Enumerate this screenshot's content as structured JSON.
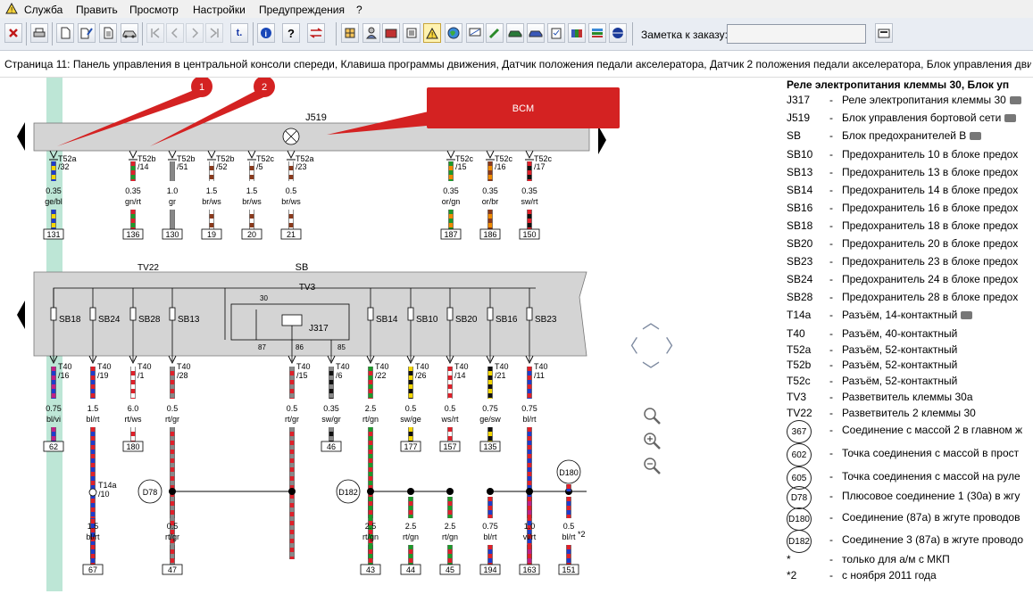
{
  "menu": {
    "items": [
      "Служба",
      "Править",
      "Просмотр",
      "Настройки",
      "Предупреждения",
      "?"
    ]
  },
  "toolbar": {
    "note_label": "Заметка к заказу:",
    "note_value": "",
    "icons": [
      "close-icon",
      "print-icon",
      "new-document-icon",
      "edit-icon",
      "document-icon",
      "car-icon",
      "first-page-icon",
      "prev-page-icon",
      "next-page-icon",
      "last-page-icon",
      "text-icon",
      "info-icon",
      "help-icon",
      "exchange-icon",
      "grid-icon",
      "person-icon",
      "book-icon",
      "list-icon",
      "warning-icon",
      "globe-icon",
      "monitor-icon",
      "pencil-icon",
      "car-icon",
      "search-car-icon",
      "clipboard-icon",
      "books-icon",
      "stack-icon",
      "disc-icon",
      "settings-icon"
    ]
  },
  "page": {
    "title": "Страница 11: Панель управления в центральной консоли спереди, Клавиша программы движения, Датчик положения педали акселератора, Датчик 2 положения педали акселератора, Блок управления двига"
  },
  "diagram": {
    "callouts": [
      "1",
      "2"
    ],
    "bcm_label": "BCM",
    "j519_label": "J519",
    "sb_label": "SB",
    "tv22_label": "TV22",
    "tv3_label": "TV3",
    "j317_label": "J317",
    "relay_pins": [
      "30",
      "87",
      "86",
      "85"
    ],
    "top_wires": [
      {
        "conn": "T52a",
        "pin": "/32",
        "size": "0.35",
        "color": "ge/bl",
        "box": "131",
        "c1": "#f4d600",
        "c2": "#1e3ccc"
      },
      {
        "conn": "T52b",
        "pin": "/14",
        "size": "0.35",
        "color": "gn/rt",
        "box": "136",
        "c1": "#1e9a2a",
        "c2": "#e0202a"
      },
      {
        "conn": "T52b",
        "pin": "/51",
        "size": "1.0",
        "color": "gr",
        "box": "130",
        "c1": "#888888",
        "c2": "#888888"
      },
      {
        "conn": "T52b",
        "pin": "/52",
        "size": "1.5",
        "color": "br/ws",
        "box": "19",
        "c1": "#8a3a1c",
        "c2": "#ffffff"
      },
      {
        "conn": "T52c",
        "pin": "/5",
        "size": "1.5",
        "color": "br/ws",
        "box": "20",
        "c1": "#8a3a1c",
        "c2": "#ffffff"
      },
      {
        "conn": "T52a",
        "pin": "/23",
        "size": "0.5",
        "color": "br/ws",
        "box": "21",
        "c1": "#8a3a1c",
        "c2": "#ffffff"
      },
      {
        "conn": "T52c",
        "pin": "/15",
        "size": "0.35",
        "color": "or/gn",
        "box": "187",
        "c1": "#f08a00",
        "c2": "#1e9a2a"
      },
      {
        "conn": "T52c",
        "pin": "/16",
        "size": "0.35",
        "color": "or/br",
        "box": "186",
        "c1": "#f08a00",
        "c2": "#8a3a1c"
      },
      {
        "conn": "T52c",
        "pin": "/17",
        "size": "0.35",
        "color": "sw/rt",
        "box": "150",
        "c1": "#111111",
        "c2": "#e0202a"
      }
    ],
    "fuses": [
      "SB18",
      "SB24",
      "SB28",
      "SB13",
      "SB14",
      "SB10",
      "SB20",
      "SB16",
      "SB23"
    ],
    "mid_wires": [
      {
        "conn": "T40",
        "pin": "/16",
        "size": "0.75",
        "color": "bl/vi",
        "box": "62",
        "c1": "#1e3ccc",
        "c2": "#c02088"
      },
      {
        "conn": "T40",
        "pin": "/19",
        "size": "1.5",
        "color": "bl/rt",
        "box": "",
        "c1": "#1e3ccc",
        "c2": "#e0202a"
      },
      {
        "conn": "T40",
        "pin": "/1",
        "size": "6.0",
        "color": "rt/ws",
        "box": "180",
        "c1": "#e0202a",
        "c2": "#ffffff"
      },
      {
        "conn": "T40",
        "pin": "/28",
        "size": "0.5",
        "color": "rt/gr",
        "box": "",
        "c1": "#e0202a",
        "c2": "#888888"
      },
      {
        "conn": "T40",
        "pin": "/15",
        "size": "0.5",
        "color": "rt/gr",
        "box": "",
        "c1": "#e0202a",
        "c2": "#888888"
      },
      {
        "conn": "T40",
        "pin": "/6",
        "size": "0.35",
        "color": "sw/gr",
        "box": "46",
        "c1": "#111111",
        "c2": "#888888"
      },
      {
        "conn": "T40",
        "pin": "/22",
        "size": "2.5",
        "color": "rt/gn",
        "box": "",
        "c1": "#e0202a",
        "c2": "#1e9a2a"
      },
      {
        "conn": "T40",
        "pin": "/26",
        "size": "0.5",
        "color": "sw/ge",
        "box": "177",
        "c1": "#111111",
        "c2": "#f4d600"
      },
      {
        "conn": "T40",
        "pin": "/14",
        "size": "0.5",
        "color": "ws/rt",
        "box": "157",
        "c1": "#ffffff",
        "c2": "#e0202a"
      },
      {
        "conn": "T40",
        "pin": "/21",
        "size": "0.75",
        "color": "ge/sw",
        "box": "135",
        "c1": "#f4d600",
        "c2": "#111111"
      },
      {
        "conn": "T40",
        "pin": "/11",
        "size": "0.75",
        "color": "bl/rt",
        "box": "",
        "c1": "#1e3ccc",
        "c2": "#e0202a"
      }
    ],
    "t14a": {
      "conn": "T14a",
      "pin": "/10"
    },
    "nodes": [
      "D78",
      "D182",
      "D180"
    ],
    "bottom_wires": [
      {
        "size": "1.5",
        "color": "bl/rt",
        "box": "67",
        "c1": "#1e3ccc",
        "c2": "#e0202a",
        "note": ""
      },
      {
        "size": "0.5",
        "color": "rt/gr",
        "box": "47",
        "c1": "#e0202a",
        "c2": "#888888",
        "note": ""
      },
      {
        "size": "2.5",
        "color": "rt/gn",
        "box": "43",
        "c1": "#e0202a",
        "c2": "#1e9a2a",
        "note": ""
      },
      {
        "size": "2.5",
        "color": "rt/gn",
        "box": "44",
        "c1": "#e0202a",
        "c2": "#1e9a2a",
        "note": ""
      },
      {
        "size": "2.5",
        "color": "rt/gn",
        "box": "45",
        "c1": "#e0202a",
        "c2": "#1e9a2a",
        "note": ""
      },
      {
        "size": "0.75",
        "color": "bl/rt",
        "box": "194",
        "c1": "#1e3ccc",
        "c2": "#e0202a",
        "note": ""
      },
      {
        "size": "1.0",
        "color": "vi/rt",
        "box": "163",
        "c1": "#c02088",
        "c2": "#e0202a",
        "note": ""
      },
      {
        "size": "0.5",
        "color": "bl/rt",
        "box": "151",
        "c1": "#1e3ccc",
        "c2": "#e0202a",
        "note": "*2"
      }
    ]
  },
  "legend": {
    "title": "Реле электропитания клеммы 30, Блок уп",
    "rows": [
      {
        "code": "J317",
        "dash": "-",
        "text": "Реле электропитания клеммы 30",
        "cam": true
      },
      {
        "code": "J519",
        "dash": "-",
        "text": "Блок управления бортовой сети",
        "cam": true
      },
      {
        "code": "SB",
        "dash": "-",
        "text": "Блок предохранителей В",
        "cam": true
      },
      {
        "code": "SB10",
        "dash": "-",
        "text": "Предохранитель 10 в блоке предох",
        "cam": false
      },
      {
        "code": "SB13",
        "dash": "-",
        "text": "Предохранитель 13 в блоке предох",
        "cam": false
      },
      {
        "code": "SB14",
        "dash": "-",
        "text": "Предохранитель 14 в блоке предох",
        "cam": false
      },
      {
        "code": "SB16",
        "dash": "-",
        "text": "Предохранитель 16 в блоке предох",
        "cam": false
      },
      {
        "code": "SB18",
        "dash": "-",
        "text": "Предохранитель 18 в блоке предох",
        "cam": false
      },
      {
        "code": "SB20",
        "dash": "-",
        "text": "Предохранитель 20 в блоке предох",
        "cam": false
      },
      {
        "code": "SB23",
        "dash": "-",
        "text": "Предохранитель 23 в блоке предох",
        "cam": false
      },
      {
        "code": "SB24",
        "dash": "-",
        "text": "Предохранитель 24 в блоке предох",
        "cam": false
      },
      {
        "code": "SB28",
        "dash": "-",
        "text": "Предохранитель 28 в блоке предох",
        "cam": false
      },
      {
        "code": "T14a",
        "dash": "-",
        "text": "Разъём, 14-контактный",
        "cam": true
      },
      {
        "code": "T40",
        "dash": "-",
        "text": "Разъём, 40-контактный",
        "cam": false
      },
      {
        "code": "T52a",
        "dash": "-",
        "text": "Разъём, 52-контактный",
        "cam": false
      },
      {
        "code": "T52b",
        "dash": "-",
        "text": "Разъём, 52-контактный",
        "cam": false
      },
      {
        "code": "T52c",
        "dash": "-",
        "text": "Разъём, 52-контактный",
        "cam": false
      },
      {
        "code": "TV3",
        "dash": "-",
        "text": "Разветвитель клеммы 30a",
        "cam": false
      },
      {
        "code": "TV22",
        "dash": "-",
        "text": "Разветвитель 2 клеммы 30",
        "cam": false
      }
    ],
    "circle_rows": [
      {
        "code": "367",
        "dash": "-",
        "text": "Соединение с массой 2 в главном ж"
      },
      {
        "code": "602",
        "dash": "-",
        "text": "Точка соединения с массой в прост"
      },
      {
        "code": "605",
        "dash": "-",
        "text": "Точка соединения с массой на руле"
      },
      {
        "code": "D78",
        "dash": "-",
        "text": "Плюсовое соединение 1 (30a) в жгу"
      },
      {
        "code": "D180",
        "dash": "-",
        "text": "Соединение (87a) в жгуте проводов"
      },
      {
        "code": "D182",
        "dash": "-",
        "text": "Соединение 3 (87a) в жгуте проводо"
      }
    ],
    "notes": [
      {
        "code": "*",
        "dash": "-",
        "text": "только для а/м с МКП"
      },
      {
        "code": "*2",
        "dash": "-",
        "text": "с ноября 2011 года"
      }
    ]
  }
}
